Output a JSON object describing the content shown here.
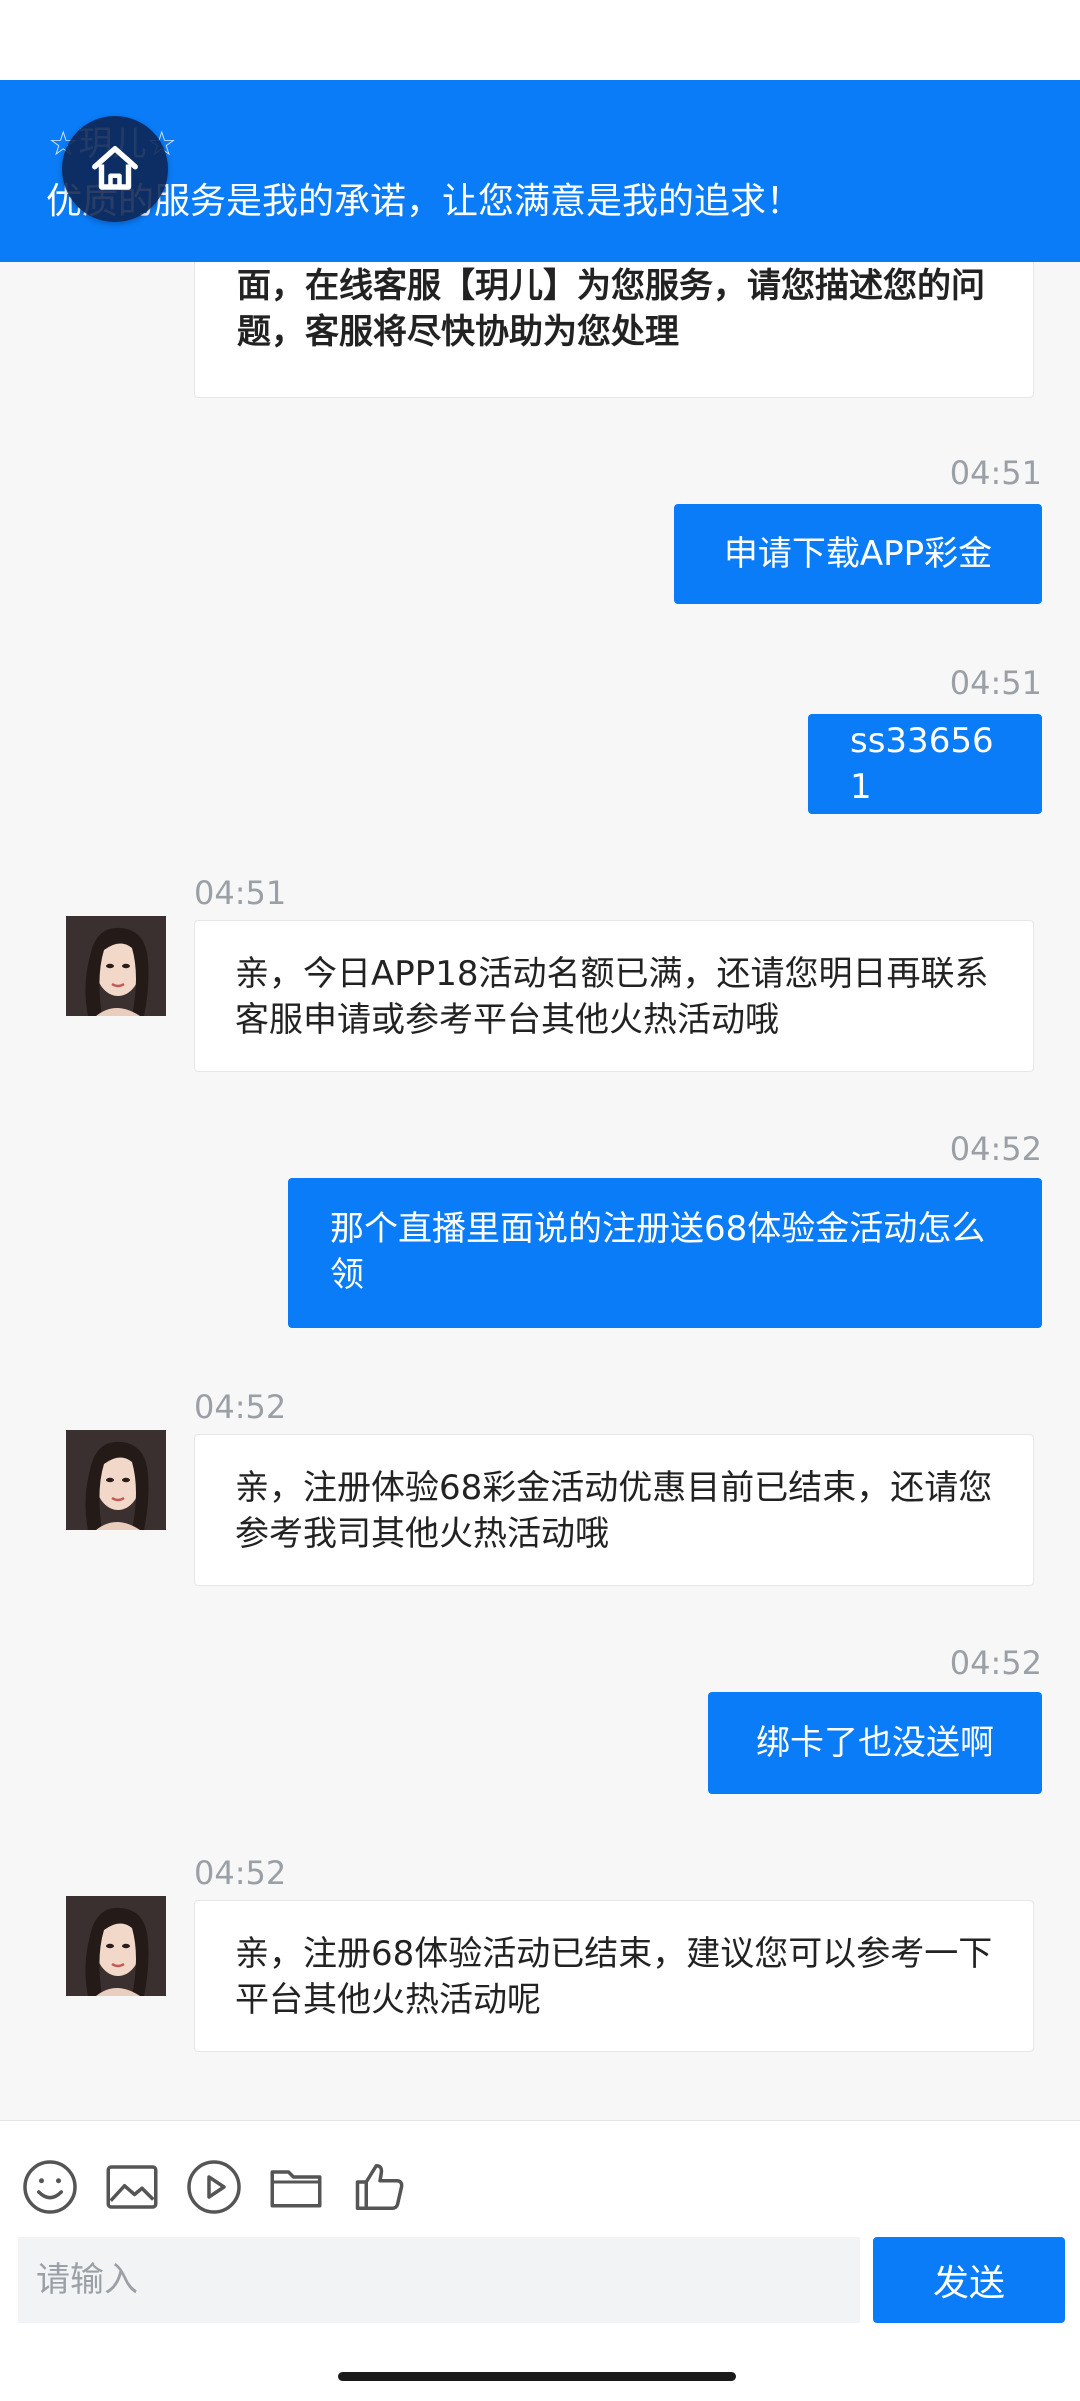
{
  "header": {
    "agent_name": "☆玥儿☆",
    "slogan": "优质的服务是我的承诺，让您满意是我的追求！"
  },
  "chat": {
    "welcome_text": "欢迎您来到【玥儿】，目前您已进入客服会话页面，在线客服【玥儿】为您服务，请您描述您的问题，客服将尽快协助为您处理",
    "messages": [
      {
        "time": "04:51",
        "text": "申请下载APP彩金"
      },
      {
        "time": "04:51",
        "text": "ss336561"
      },
      {
        "time": "04:51",
        "text": "亲，今日APP18活动名额已满，还请您明日再联系客服申请或参考平台其他火热活动哦"
      },
      {
        "time": "04:52",
        "text": "那个直播里面说的注册送68体验金活动怎么领"
      },
      {
        "time": "04:52",
        "text": "亲，注册体验68彩金活动优惠目前已结束，还请您参考我司其他火热活动哦"
      },
      {
        "time": "04:52",
        "text": "绑卡了也没送啊"
      },
      {
        "time": "04:52",
        "text": "亲，注册68体验活动已结束，建议您可以参考一下平台其他火热活动呢"
      }
    ]
  },
  "composer": {
    "placeholder": "请输入",
    "send_label": "发送"
  },
  "colors": {
    "accent": "#0a7cf8",
    "background": "#f7f7f7"
  },
  "icons": [
    "home-icon",
    "emoji-icon",
    "image-icon",
    "video-icon",
    "folder-icon",
    "thumbs-up-icon"
  ]
}
